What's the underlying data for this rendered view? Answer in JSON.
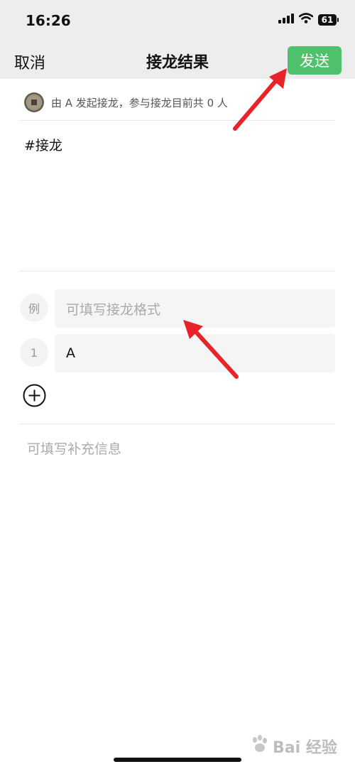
{
  "status_bar": {
    "time": "16:26",
    "battery_level": "61",
    "icons": [
      "cellular-signal-icon",
      "wifi-icon",
      "battery-icon"
    ]
  },
  "nav": {
    "cancel_label": "取消",
    "title": "接龙结果",
    "send_label": "发送",
    "send_color": "#4fc06b"
  },
  "initiator": {
    "text": "由 A 发起接龙，参与接龙目前共 0 人"
  },
  "topic": {
    "text": "#接龙"
  },
  "entries": [
    {
      "badge": "例",
      "placeholder": "可填写接龙格式",
      "value": ""
    },
    {
      "badge": "1",
      "placeholder": "",
      "value": "A"
    }
  ],
  "supplement": {
    "placeholder": "可填写补充信息"
  },
  "watermark": {
    "text": "Bai 经验"
  },
  "colors": {
    "header_bg": "#ededed",
    "accent_green": "#4fc06b",
    "annotation_red": "#e8232a"
  }
}
